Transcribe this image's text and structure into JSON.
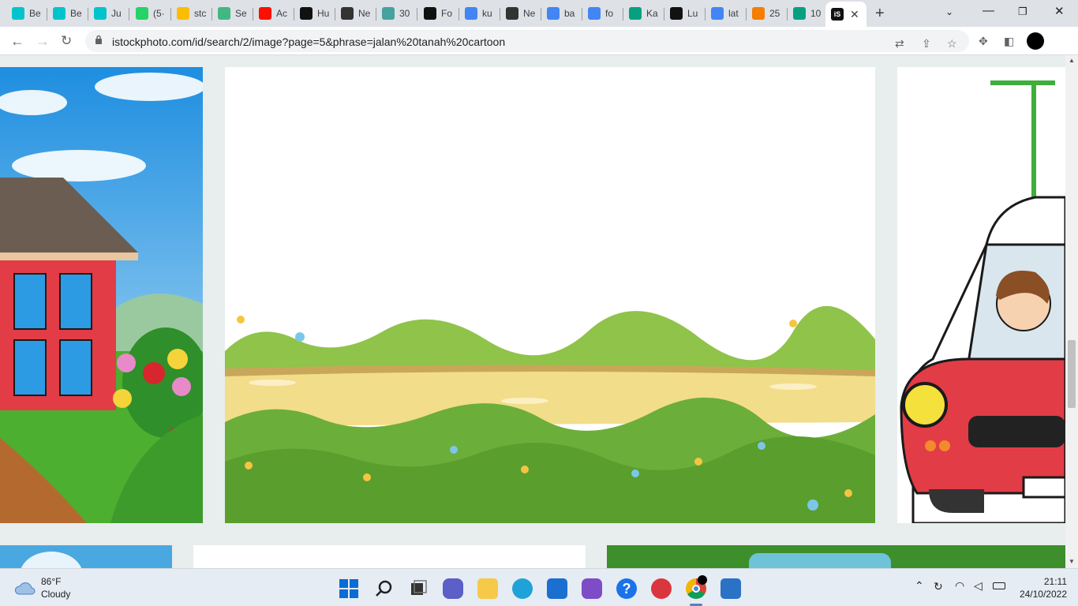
{
  "browser": {
    "tabs": [
      {
        "label": "Be",
        "icon": "canva-icon",
        "color": "#00c4cc"
      },
      {
        "label": "Be",
        "icon": "canva-icon",
        "color": "#00c4cc"
      },
      {
        "label": "Ju",
        "icon": "canva-icon",
        "color": "#00c4cc"
      },
      {
        "label": "(5·",
        "icon": "whatsapp-icon",
        "color": "#25d366"
      },
      {
        "label": "stc",
        "icon": "google-drive-icon",
        "color": "#fbbc04"
      },
      {
        "label": "Se",
        "icon": "vue-icon",
        "color": "#41b883"
      },
      {
        "label": "Ac",
        "icon": "adobe-icon",
        "color": "#fa0f00"
      },
      {
        "label": "Hu",
        "icon": "st-icon",
        "color": "#111111"
      },
      {
        "label": "Ne",
        "icon": "github-icon",
        "color": "#333333"
      },
      {
        "label": "30",
        "icon": "d-icon",
        "color": "#45a29e"
      },
      {
        "label": "Fo",
        "icon": "istock-icon",
        "color": "#111111"
      },
      {
        "label": "ku",
        "icon": "google-icon",
        "color": "#4285f4"
      },
      {
        "label": "Ne",
        "icon": "github-icon",
        "color": "#333333"
      },
      {
        "label": "ba",
        "icon": "google-icon",
        "color": "#4285f4"
      },
      {
        "label": "fo",
        "icon": "google-icon",
        "color": "#4285f4"
      },
      {
        "label": "Ka",
        "icon": "pexels-icon",
        "color": "#05a081"
      },
      {
        "label": "Lu",
        "icon": "istock-icon",
        "color": "#111111"
      },
      {
        "label": "lat",
        "icon": "google-icon",
        "color": "#4285f4"
      },
      {
        "label": "25",
        "icon": "blogger-icon",
        "color": "#f57d00"
      },
      {
        "label": "10",
        "icon": "pexels-icon",
        "color": "#05a081"
      }
    ],
    "active_tab": {
      "icon": "istock-icon",
      "color": "#111111"
    },
    "url": "istockphoto.com/id/search/2/image?page=5&phrase=jalan%20tanah%20cartoon"
  },
  "taskbar": {
    "weather_temp": "86°F",
    "weather_desc": "Cloudy",
    "time": "21:11",
    "date": "24/10/2022",
    "apps": [
      "start-icon",
      "search-icon",
      "task-view-icon",
      "teams-chat-icon",
      "file-explorer-icon",
      "edge-icon",
      "store-icon",
      "app-icon",
      "help-icon",
      "game-icon",
      "chrome-icon",
      "photos-icon"
    ]
  },
  "colors": {
    "accent_green": "#6cae3a",
    "path_yellow": "#f2dd8a",
    "sky_blue": "#2d9be4",
    "car_red": "#e23c47"
  }
}
